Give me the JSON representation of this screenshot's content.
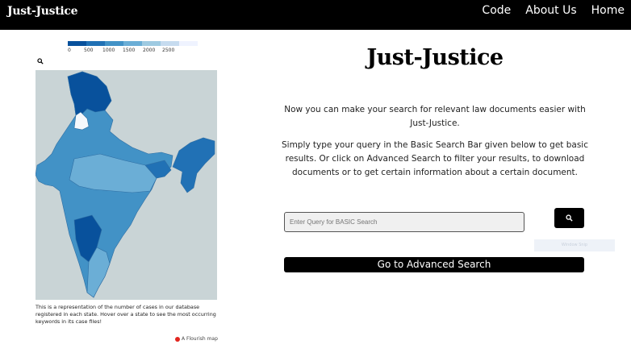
{
  "nav": {
    "brand": "Just-Justice",
    "links": [
      "Code",
      "About Us",
      "Home"
    ]
  },
  "map": {
    "legend": {
      "ticks": [
        "0",
        "500",
        "1000",
        "1500",
        "2000",
        "2500"
      ],
      "colors": [
        "#08519c",
        "#2171b5",
        "#4292c6",
        "#6baed6",
        "#9ecae1",
        "#c6dbef",
        "#eff3ff"
      ]
    },
    "search_icon": "search-icon",
    "caption": "This is a representation of the number of cases in our database registered in each state. Hover over a state to see the most occurring keywords in its case files!",
    "credit": "A Flourish map"
  },
  "main": {
    "title": "Just-Justice",
    "intro": "Now you can make your search for relevant law documents easier with Just-Justice.",
    "instructions": "Simply type your query in the Basic Search Bar given below to get basic results. Or click on Advanced Search to filter your results, to download documents or to get certain information about a certain document.",
    "search": {
      "placeholder": "Enter Query for BASIC Search",
      "button_icon": "search-icon"
    },
    "ghost_hint": "Window Snip",
    "advanced_label": "Go to Advanced Search"
  }
}
